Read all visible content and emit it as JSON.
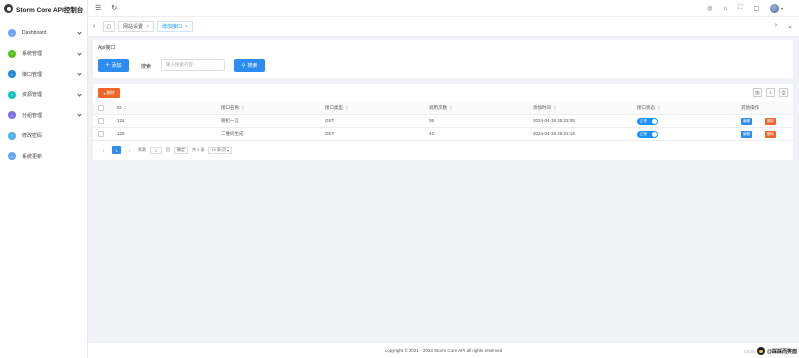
{
  "app": {
    "title": "Storm Core API控制台"
  },
  "sidebar": {
    "items": [
      {
        "label": "Dashboard",
        "color": "#6aa6f8",
        "expandable": true
      },
      {
        "label": "系统管理",
        "color": "#52c41a",
        "expandable": true
      },
      {
        "label": "接口管理",
        "color": "#1e8bd6",
        "expandable": true
      },
      {
        "label": "资源管理",
        "color": "#13c2c2",
        "expandable": true
      },
      {
        "label": "分组管理",
        "color": "#7b6cf0",
        "expandable": true
      },
      {
        "label": "修改密码",
        "color": "#4ab3e6",
        "expandable": false
      },
      {
        "label": "系统更新",
        "color": "#5fa8f5",
        "expandable": false
      }
    ]
  },
  "header": {
    "icons": [
      "menu-toggle-icon",
      "refresh-icon",
      "github-icon",
      "tag-icon",
      "fullscreen-icon",
      "lock-icon",
      "avatar",
      "chevron-down-icon"
    ]
  },
  "tabs": {
    "items": [
      {
        "label": "网站设置",
        "active": false
      },
      {
        "label": "增加接口",
        "active": true
      }
    ]
  },
  "toolbar": {
    "heading": "Api接口",
    "add_label": "添加",
    "search_label": "搜索",
    "search_placeholder": "输入搜索内容",
    "search_button": "搜索",
    "delete_label": "删除"
  },
  "table": {
    "columns": [
      "ID",
      "接口名称",
      "接口类型",
      "调用次数",
      "添加时间",
      "接口状态",
      "其他操作"
    ],
    "rows": [
      {
        "id": "124",
        "name": "随机一言",
        "type": "GET",
        "calls": "36",
        "added": "2024-04-19 25:23:08",
        "status": "正常",
        "edit": "编辑",
        "delete": "删除"
      },
      {
        "id": "125",
        "name": "二维码生成",
        "type": "GET",
        "calls": "42",
        "added": "2024-04-19 25:22:14",
        "status": "正常",
        "edit": "编辑",
        "delete": "删除"
      }
    ]
  },
  "pagination": {
    "prev": "‹",
    "page": "1",
    "next": "›",
    "goto_label": "到第",
    "goto_value": "1",
    "page_unit": "页",
    "confirm": "确定",
    "total": "共 2 条",
    "per_page": "10 条/页"
  },
  "footer": {
    "text": "copyright © 2021 - 2023 Storm Core API all rights reserved"
  },
  "watermark": {
    "prefix": "CSDN",
    "name": "@踩踩而笑面"
  },
  "colors": {
    "primary": "#2d8cf0",
    "danger": "#f0652a",
    "switch": "#1e90ff"
  }
}
